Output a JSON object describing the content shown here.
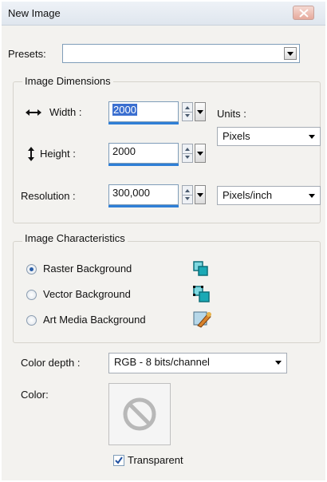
{
  "window": {
    "title": "New Image"
  },
  "presets": {
    "label": "Presets:",
    "value": ""
  },
  "dimensions": {
    "group_title": "Image Dimensions",
    "width_label": "Width :",
    "width_value": "2000",
    "height_label": "Height :",
    "height_value": "2000",
    "resolution_label": "Resolution :",
    "resolution_value": "300,000",
    "units_label": "Units :",
    "units_value": "Pixels",
    "resolution_units_value": "Pixels/inch"
  },
  "characteristics": {
    "group_title": "Image Characteristics",
    "options": [
      {
        "label": "Raster Background",
        "selected": true,
        "icon": "raster-layer-icon"
      },
      {
        "label": "Vector Background",
        "selected": false,
        "icon": "vector-layer-icon"
      },
      {
        "label": "Art Media Background",
        "selected": false,
        "icon": "art-media-icon"
      }
    ]
  },
  "color": {
    "depth_label": "Color depth :",
    "depth_value": "RGB - 8 bits/channel",
    "color_label": "Color:",
    "transparent_label": "Transparent",
    "transparent_checked": true
  },
  "colors": {
    "accent": "#2f7fd6",
    "selection": "#3b6fd0",
    "icon_teal": "#1aa9b5"
  }
}
